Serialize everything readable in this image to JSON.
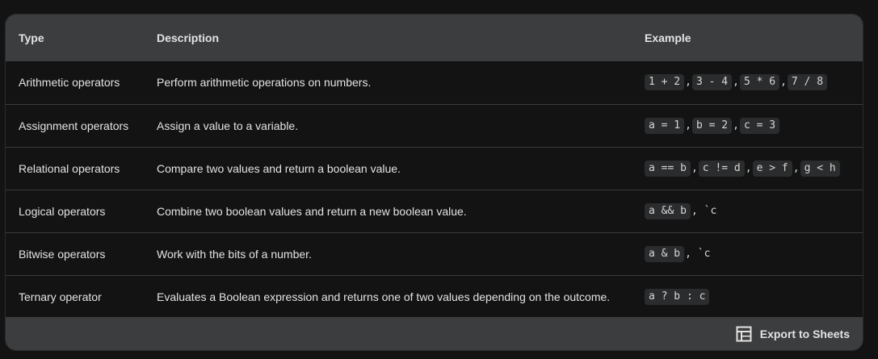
{
  "table": {
    "headers": [
      "Type",
      "Description",
      "Example"
    ],
    "rows": [
      {
        "type": "Arithmetic operators",
        "description": "Perform arithmetic operations on numbers.",
        "examples": [
          "1 + 2",
          "3 - 4",
          "5 * 6",
          "7 / 8"
        ],
        "trailing": ""
      },
      {
        "type": "Assignment operators",
        "description": "Assign a value to a variable.",
        "examples": [
          "a = 1",
          "b = 2",
          "c = 3"
        ],
        "trailing": ""
      },
      {
        "type": "Relational operators",
        "description": "Compare two values and return a boolean value.",
        "examples": [
          "a == b",
          "c != d",
          "e > f",
          "g < h"
        ],
        "trailing": ""
      },
      {
        "type": "Logical operators",
        "description": "Combine two boolean values and return a new boolean value.",
        "examples": [
          "a && b"
        ],
        "trailing": ", `c"
      },
      {
        "type": "Bitwise operators",
        "description": "Work with the bits of a number.",
        "examples": [
          "a & b"
        ],
        "trailing": ", `c"
      },
      {
        "type": "Ternary operator",
        "description": "Evaluates a Boolean expression and returns one of two values depending on the outcome.",
        "examples": [
          "a ? b : c"
        ],
        "trailing": ""
      }
    ]
  },
  "footer": {
    "export_label": "Export to Sheets",
    "export_icon": "table-grid-icon"
  }
}
